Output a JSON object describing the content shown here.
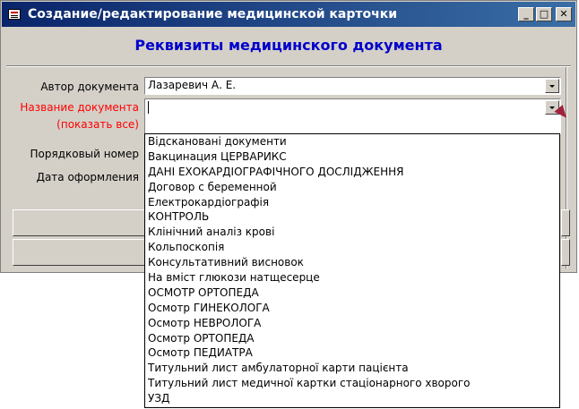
{
  "window": {
    "title": "Создание/редактирование медицинской карточки"
  },
  "header": {
    "title": "Реквизиты медицинского документа"
  },
  "fields": {
    "author_label": "Автор документа",
    "author_value": "Лазаревич А. Е.",
    "docname_label": "Название документа",
    "show_all_label": "(показать все)",
    "docname_value": "",
    "order_label": "Порядковый номер",
    "date_label": "Дата оформления"
  },
  "dropdown": {
    "items": [
      "Відскановані документи",
      "Вакцинация ЦЕРВАРИКС",
      "ДАНІ ЕХОКАРДІОГРАФІЧНОГО ДОСЛІДЖЕННЯ",
      "Договор с беременной",
      "Електрокардіографія",
      "КОНТРОЛЬ",
      "Клінічний аналіз крові",
      "Кольпоскопія",
      "Консультативний висновок",
      "На вміст глюкози натщесерце",
      "ОСМОТР ОРТОПЕДА",
      "Осмотр ГИНЕКОЛОГА",
      "Осмотр НЕВРОЛОГА",
      "Осмотр ОРТОПЕДА",
      "Осмотр ПЕДИАТРА",
      "Титульний лист амбулаторної карти пацієнта",
      "Титульний лист медичної картки стаціонарного хворого",
      "УЗД"
    ]
  },
  "colors": {
    "title_gradient_start": "#0a246a",
    "title_gradient_end": "#3a6ea5",
    "header_text": "#0000cc",
    "required_label": "#ff0000",
    "window_bg": "#d4d0c8"
  },
  "icons": {
    "title": "form-icon",
    "minimize": "minimize-icon",
    "maximize": "maximize-icon",
    "close": "close-icon",
    "dropdown": "chevron-down-icon",
    "cursor": "mouse-pointer-icon"
  }
}
